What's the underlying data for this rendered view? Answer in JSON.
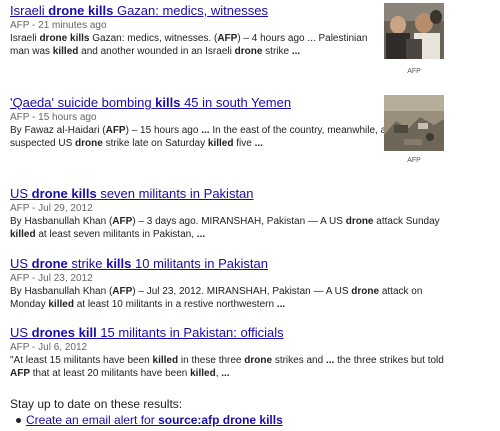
{
  "results": [
    {
      "title": [
        "Israeli ",
        "drone",
        " ",
        "kills",
        " Gazan: medics, witnesses"
      ],
      "meta": "AFP - 21 minutes ago",
      "snippet1": [
        "Israeli ",
        "drone",
        " ",
        "kills",
        " Gazan: medics, witnesses. (",
        "AFP",
        ") – 4 hours ago ... Palestinian"
      ],
      "snippet2": [
        "man was ",
        "killed",
        " and another wounded in an Israeli ",
        "drone",
        " strike ",
        "..."
      ],
      "thumb_caption": "AFP"
    },
    {
      "title": [
        "'Qaeda' suicide bombing ",
        "kills",
        " 45 in south Yemen"
      ],
      "meta": "AFP - 15 hours ago",
      "snippet1": [
        "By Fawaz al-Haidari (",
        "AFP",
        ") – 15 hours ago ",
        "...",
        " In the east of the country, meanwhile, a"
      ],
      "snippet2": [
        "suspected US ",
        "drone",
        " strike late on Saturday ",
        "killed",
        " five ",
        "..."
      ],
      "thumb_caption": "AFP"
    },
    {
      "title": [
        "US ",
        "drone",
        " ",
        "kills",
        " seven militants in Pakistan"
      ],
      "meta": "AFP - Jul 29, 2012",
      "snippet1": [
        "By Hasbanullah Khan (",
        "AFP",
        ") – 3 days ago. MIRANSHAH, Pakistan — A US ",
        "drone",
        " attack Sunday"
      ],
      "snippet2": [
        "killed",
        " at least seven militants in Pakistan, ",
        "..."
      ]
    },
    {
      "title": [
        "US ",
        "drone",
        " strike ",
        "kills",
        " 10 militants in Pakistan"
      ],
      "meta": "AFP - Jul 23, 2012",
      "snippet1": [
        "By Hasbanullah Khan (",
        "AFP",
        ") – Jul 23, 2012. MIRANSHAH, Pakistan — A US ",
        "drone",
        " attack on"
      ],
      "snippet2": [
        "Monday ",
        "killed",
        " at least 10 militants in a restive northwestern ",
        "..."
      ]
    },
    {
      "title": [
        "US ",
        "drones",
        " ",
        "kill",
        " 15 militants in Pakistan: officials"
      ],
      "meta": "AFP - Jul 6, 2012",
      "snippet1": [
        "\"At least 15 militants have been ",
        "killed",
        " in these three ",
        "drone",
        " strikes and ",
        "...",
        " the three strikes but told"
      ],
      "snippet2": [
        "AFP",
        " that at least 20 militants have been ",
        "killed",
        ", ",
        "..."
      ]
    }
  ],
  "footer": {
    "text": "Stay up to date on these results:",
    "alert_prefix": "Create an email alert for ",
    "alert_query": "source:afp drone kills"
  }
}
